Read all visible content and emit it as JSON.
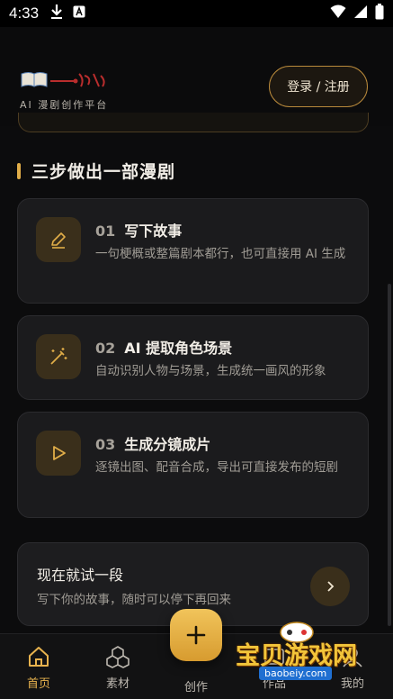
{
  "status_bar": {
    "time": "4:33"
  },
  "header": {
    "logo_subtitle": "AI 漫剧创作平台",
    "login_label": "登录 / 注册"
  },
  "section": {
    "title": "三步做出一部漫剧"
  },
  "steps": [
    {
      "num": "01",
      "title": "写下故事",
      "desc": "一句梗概或整篇剧本都行，也可直接用 AI 生成"
    },
    {
      "num": "02",
      "title": "AI 提取角色场景",
      "desc": "自动识别人物与场景，生成统一画风的形象"
    },
    {
      "num": "03",
      "title": "生成分镜成片",
      "desc": "逐镜出图、配音合成，导出可直接发布的短剧"
    }
  ],
  "try_card": {
    "title": "现在就试一段",
    "subtitle": "写下你的故事，随时可以停下再回来"
  },
  "bottom_nav": {
    "home": "首页",
    "materials": "素材",
    "create": "创作",
    "works": "作品",
    "mine": "我的"
  },
  "watermark": {
    "text": "宝贝游戏网",
    "url": "baobeiy.com"
  },
  "colors": {
    "accent": "#e0ad48",
    "card": "#1b1b1d",
    "background": "#0c0c0d"
  }
}
